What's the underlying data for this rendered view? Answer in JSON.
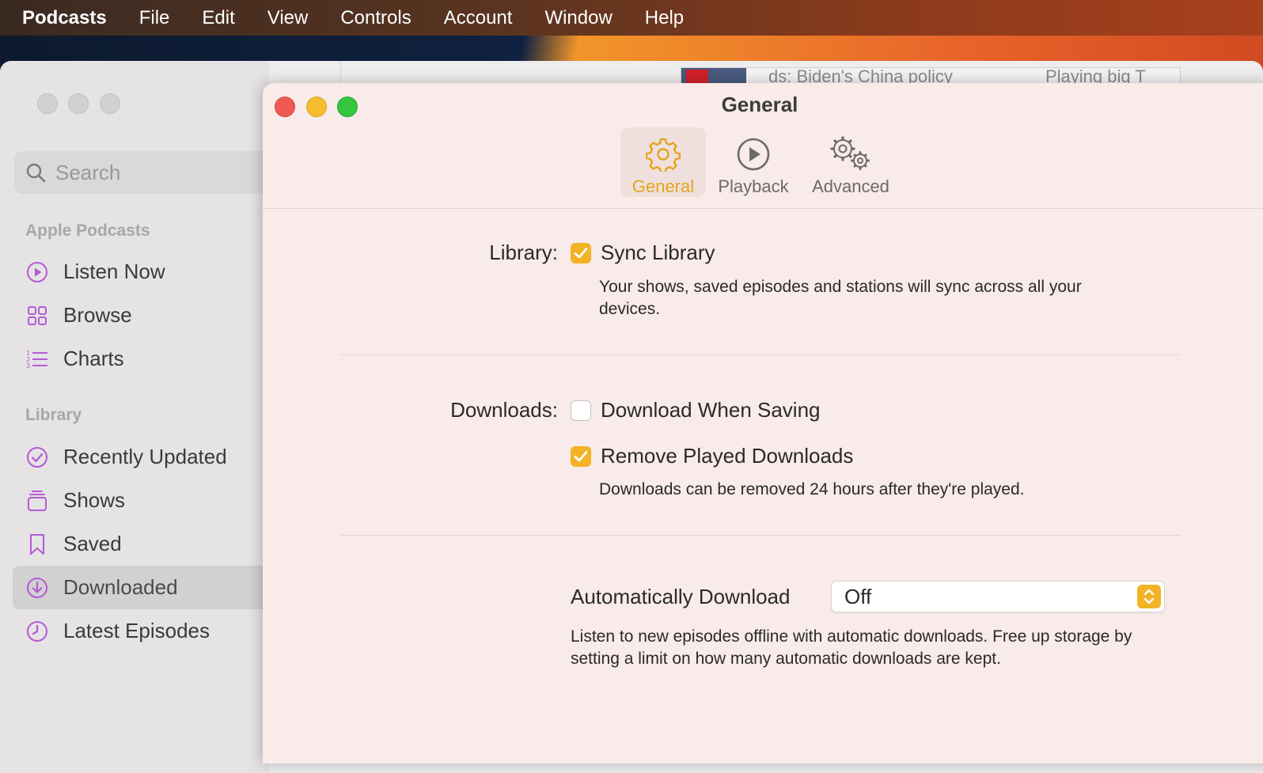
{
  "menubar": {
    "app": "Podcasts",
    "items": [
      "File",
      "Edit",
      "View",
      "Controls",
      "Account",
      "Window",
      "Help"
    ]
  },
  "sidebar": {
    "search_placeholder": "Search",
    "sections": [
      {
        "title": "Apple Podcasts",
        "items": [
          {
            "label": "Listen Now",
            "icon": "play-circle-icon"
          },
          {
            "label": "Browse",
            "icon": "grid-icon"
          },
          {
            "label": "Charts",
            "icon": "list-icon"
          }
        ]
      },
      {
        "title": "Library",
        "items": [
          {
            "label": "Recently Updated",
            "icon": "check-circle-icon"
          },
          {
            "label": "Shows",
            "icon": "stack-icon"
          },
          {
            "label": "Saved",
            "icon": "bookmark-icon"
          },
          {
            "label": "Downloaded",
            "icon": "download-circle-icon",
            "selected": true
          },
          {
            "label": "Latest Episodes",
            "icon": "clock-icon"
          }
        ]
      }
    ]
  },
  "miniplayer": {
    "title": "ds: Biden's China policy",
    "subtitle": "Playing big T"
  },
  "prefs": {
    "window_title": "General",
    "tabs": [
      {
        "label": "General",
        "icon": "gear-icon",
        "active": true
      },
      {
        "label": "Playback",
        "icon": "play-circle-icon"
      },
      {
        "label": "Advanced",
        "icon": "gears-icon"
      }
    ],
    "library": {
      "label": "Library:",
      "sync_label": "Sync Library",
      "sync_checked": true,
      "desc": "Your shows, saved episodes and stations will sync across all your devices."
    },
    "downloads": {
      "label": "Downloads:",
      "when_saving_label": "Download When Saving",
      "when_saving_checked": false,
      "remove_played_label": "Remove Played Downloads",
      "remove_played_checked": true,
      "remove_desc": "Downloads can be removed 24 hours after they're played."
    },
    "auto_download": {
      "label": "Automatically Download",
      "value": "Off",
      "desc": "Listen to new episodes offline with automatic downloads. Free up storage by setting a limit on how many automatic downloads are kept."
    }
  },
  "colors": {
    "accent": "#f3b326",
    "sidebar_icon": "#b35ad6"
  }
}
